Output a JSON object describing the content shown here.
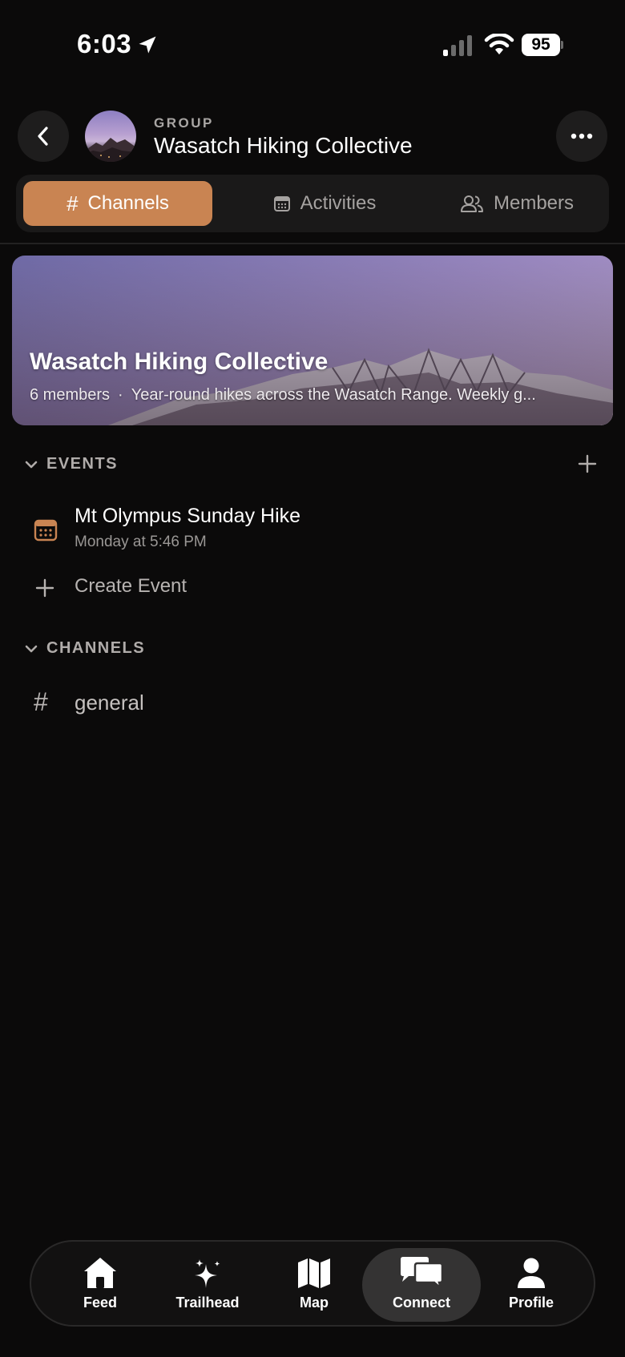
{
  "status_bar": {
    "time": "6:03",
    "battery": "95"
  },
  "header": {
    "eyebrow": "GROUP",
    "title": "Wasatch Hiking Collective"
  },
  "tabs": [
    {
      "label": "Channels",
      "icon": "hash-icon",
      "active": true
    },
    {
      "label": "Activities",
      "icon": "calendar-icon",
      "active": false
    },
    {
      "label": "Members",
      "icon": "people-icon",
      "active": false
    }
  ],
  "banner": {
    "title": "Wasatch Hiking Collective",
    "members": "6 members",
    "description": "Year-round hikes across the Wasatch Range. Weekly g..."
  },
  "events_section": {
    "heading": "EVENTS",
    "events": [
      {
        "title": "Mt Olympus Sunday Hike",
        "time": "Monday at 5:46 PM"
      }
    ],
    "create_label": "Create Event"
  },
  "channels_section": {
    "heading": "CHANNELS",
    "channels": [
      {
        "name": "general"
      }
    ]
  },
  "bottom_nav": [
    {
      "label": "Feed",
      "icon": "home-icon",
      "active": false
    },
    {
      "label": "Trailhead",
      "icon": "sparkles-icon",
      "active": false
    },
    {
      "label": "Map",
      "icon": "map-icon",
      "active": false
    },
    {
      "label": "Connect",
      "icon": "chat-bubbles-icon",
      "active": true
    },
    {
      "label": "Profile",
      "icon": "person-icon",
      "active": false
    }
  ],
  "colors": {
    "accent": "#c98452",
    "background": "#0b0a0a"
  }
}
